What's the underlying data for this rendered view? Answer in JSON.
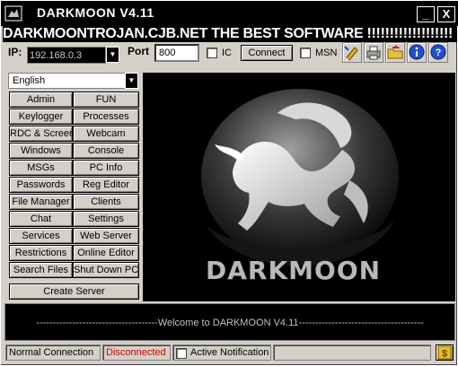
{
  "window": {
    "title": "DARKMOON V4.11",
    "minimize_glyph": "_",
    "close_glyph": "X"
  },
  "banner": {
    "text": "DARKMOONTROJAN.CJB.NET THE BEST SOFTWARE !!!!!!!!!!!!!!!!!!!"
  },
  "connection": {
    "ip_label": "IP:",
    "ip_value": "192.168.0.3",
    "port_label": "Port",
    "port_value": "800",
    "ic_label": "IC",
    "connect_label": "Connect",
    "msn_label": "MSN"
  },
  "toolbar_icons": [
    "pencil-icon",
    "printer-icon",
    "folder-arrow-icon",
    "info-icon",
    "help-icon"
  ],
  "language": {
    "selected": "English"
  },
  "menu_buttons": [
    [
      "Admin",
      "FUN"
    ],
    [
      "Keylogger",
      "Processes"
    ],
    [
      "RDC & Screen",
      "Webcam"
    ],
    [
      "Windows",
      "Console"
    ],
    [
      "MSGs",
      "PC Info"
    ],
    [
      "Passwords",
      "Reg Editor"
    ],
    [
      "File Manager",
      "Clients"
    ],
    [
      "Chat",
      "Settings"
    ],
    [
      "Services",
      "Web Server"
    ],
    [
      "Restrictions",
      "Online Editor"
    ],
    [
      "Search Files",
      "Shut Down PC"
    ]
  ],
  "create_server_label": "Create Server",
  "logo": {
    "text": "DARKMOON"
  },
  "console": {
    "welcome": "-------------------------------------Welcome to DARKMOON V4.11--------------------------------------"
  },
  "statusbar": {
    "connection_type": "Normal Connection",
    "connection_state": "Disconnected",
    "notification_label": "Active Notification",
    "state_color": "#cc0000"
  }
}
